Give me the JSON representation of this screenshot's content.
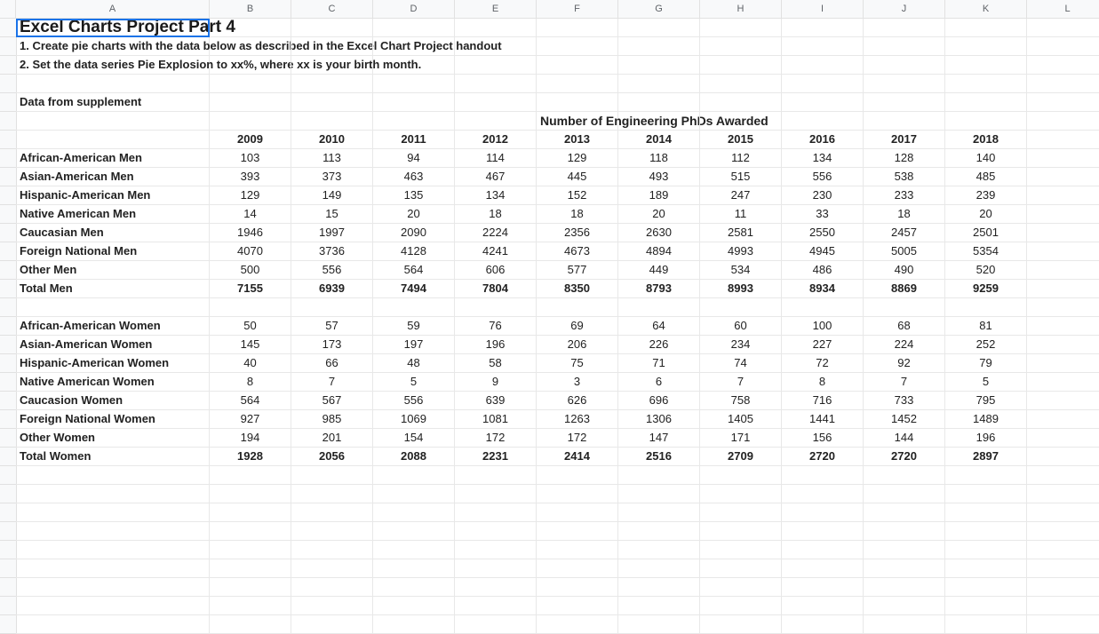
{
  "columns": [
    "A",
    "B",
    "C",
    "D",
    "E",
    "F",
    "G",
    "H",
    "I",
    "J",
    "K",
    "L"
  ],
  "title": "Excel Charts Project Part 4",
  "instructions": [
    "1. Create pie charts with the data below as described in the Excel Chart Project handout",
    "2. Set the data series Pie Explosion to xx%, where xx is your birth month."
  ],
  "supplement_label": "Data from supplement",
  "table_title": "Number of Engineering PhDs Awarded",
  "years": [
    "2009",
    "2010",
    "2011",
    "2012",
    "2013",
    "2014",
    "2015",
    "2016",
    "2017",
    "2018"
  ],
  "men": [
    {
      "label": "African-American Men",
      "v": [
        103,
        113,
        94,
        114,
        129,
        118,
        112,
        134,
        128,
        140
      ]
    },
    {
      "label": "Asian-American Men",
      "v": [
        393,
        373,
        463,
        467,
        445,
        493,
        515,
        556,
        538,
        485
      ]
    },
    {
      "label": "Hispanic-American Men",
      "v": [
        129,
        149,
        135,
        134,
        152,
        189,
        247,
        230,
        233,
        239
      ]
    },
    {
      "label": "Native American Men",
      "v": [
        14,
        15,
        20,
        18,
        18,
        20,
        11,
        33,
        18,
        20
      ]
    },
    {
      "label": "Caucasian Men",
      "v": [
        1946,
        1997,
        2090,
        2224,
        2356,
        2630,
        2581,
        2550,
        2457,
        2501
      ]
    },
    {
      "label": "Foreign National Men",
      "v": [
        4070,
        3736,
        4128,
        4241,
        4673,
        4894,
        4993,
        4945,
        5005,
        5354
      ]
    },
    {
      "label": "Other Men",
      "v": [
        500,
        556,
        564,
        606,
        577,
        449,
        534,
        486,
        490,
        520
      ]
    }
  ],
  "men_total": {
    "label": "Total Men",
    "v": [
      7155,
      6939,
      7494,
      7804,
      8350,
      8793,
      8993,
      8934,
      8869,
      9259
    ]
  },
  "women": [
    {
      "label": "African-American Women",
      "v": [
        50,
        57,
        59,
        76,
        69,
        64,
        60,
        100,
        68,
        81
      ]
    },
    {
      "label": "Asian-American Women",
      "v": [
        145,
        173,
        197,
        196,
        206,
        226,
        234,
        227,
        224,
        252
      ]
    },
    {
      "label": "Hispanic-American Women",
      "v": [
        40,
        66,
        48,
        58,
        75,
        71,
        74,
        72,
        92,
        79
      ]
    },
    {
      "label": "Native American Women",
      "v": [
        8,
        7,
        5,
        9,
        3,
        6,
        7,
        8,
        7,
        5
      ]
    },
    {
      "label": "Caucasion Women",
      "v": [
        564,
        567,
        556,
        639,
        626,
        696,
        758,
        716,
        733,
        795
      ]
    },
    {
      "label": "Foreign National Women",
      "v": [
        927,
        985,
        1069,
        1081,
        1263,
        1306,
        1405,
        1441,
        1452,
        1489
      ]
    },
    {
      "label": "Other Women",
      "v": [
        194,
        201,
        154,
        172,
        172,
        147,
        171,
        156,
        144,
        196
      ]
    }
  ],
  "women_total": {
    "label": "Total Women",
    "v": [
      1928,
      2056,
      2088,
      2231,
      2414,
      2516,
      2709,
      2720,
      2720,
      2897
    ]
  },
  "chart_data": {
    "type": "table",
    "title": "Number of Engineering PhDs Awarded",
    "x": [
      "2009",
      "2010",
      "2011",
      "2012",
      "2013",
      "2014",
      "2015",
      "2016",
      "2017",
      "2018"
    ],
    "series": [
      {
        "name": "African-American Men",
        "values": [
          103,
          113,
          94,
          114,
          129,
          118,
          112,
          134,
          128,
          140
        ]
      },
      {
        "name": "Asian-American Men",
        "values": [
          393,
          373,
          463,
          467,
          445,
          493,
          515,
          556,
          538,
          485
        ]
      },
      {
        "name": "Hispanic-American Men",
        "values": [
          129,
          149,
          135,
          134,
          152,
          189,
          247,
          230,
          233,
          239
        ]
      },
      {
        "name": "Native American Men",
        "values": [
          14,
          15,
          20,
          18,
          18,
          20,
          11,
          33,
          18,
          20
        ]
      },
      {
        "name": "Caucasian Men",
        "values": [
          1946,
          1997,
          2090,
          2224,
          2356,
          2630,
          2581,
          2550,
          2457,
          2501
        ]
      },
      {
        "name": "Foreign National Men",
        "values": [
          4070,
          3736,
          4128,
          4241,
          4673,
          4894,
          4993,
          4945,
          5005,
          5354
        ]
      },
      {
        "name": "Other Men",
        "values": [
          500,
          556,
          564,
          606,
          577,
          449,
          534,
          486,
          490,
          520
        ]
      },
      {
        "name": "Total Men",
        "values": [
          7155,
          6939,
          7494,
          7804,
          8350,
          8793,
          8993,
          8934,
          8869,
          9259
        ]
      },
      {
        "name": "African-American Women",
        "values": [
          50,
          57,
          59,
          76,
          69,
          64,
          60,
          100,
          68,
          81
        ]
      },
      {
        "name": "Asian-American Women",
        "values": [
          145,
          173,
          197,
          196,
          206,
          226,
          234,
          227,
          224,
          252
        ]
      },
      {
        "name": "Hispanic-American Women",
        "values": [
          40,
          66,
          48,
          58,
          75,
          71,
          74,
          72,
          92,
          79
        ]
      },
      {
        "name": "Native American Women",
        "values": [
          8,
          7,
          5,
          9,
          3,
          6,
          7,
          8,
          7,
          5
        ]
      },
      {
        "name": "Caucasion Women",
        "values": [
          564,
          567,
          556,
          639,
          626,
          696,
          758,
          716,
          733,
          795
        ]
      },
      {
        "name": "Foreign National Women",
        "values": [
          927,
          985,
          1069,
          1081,
          1263,
          1306,
          1405,
          1441,
          1452,
          1489
        ]
      },
      {
        "name": "Other Women",
        "values": [
          194,
          201,
          154,
          172,
          172,
          147,
          171,
          156,
          144,
          196
        ]
      },
      {
        "name": "Total Women",
        "values": [
          1928,
          2056,
          2088,
          2231,
          2414,
          2516,
          2709,
          2720,
          2720,
          2897
        ]
      }
    ]
  }
}
